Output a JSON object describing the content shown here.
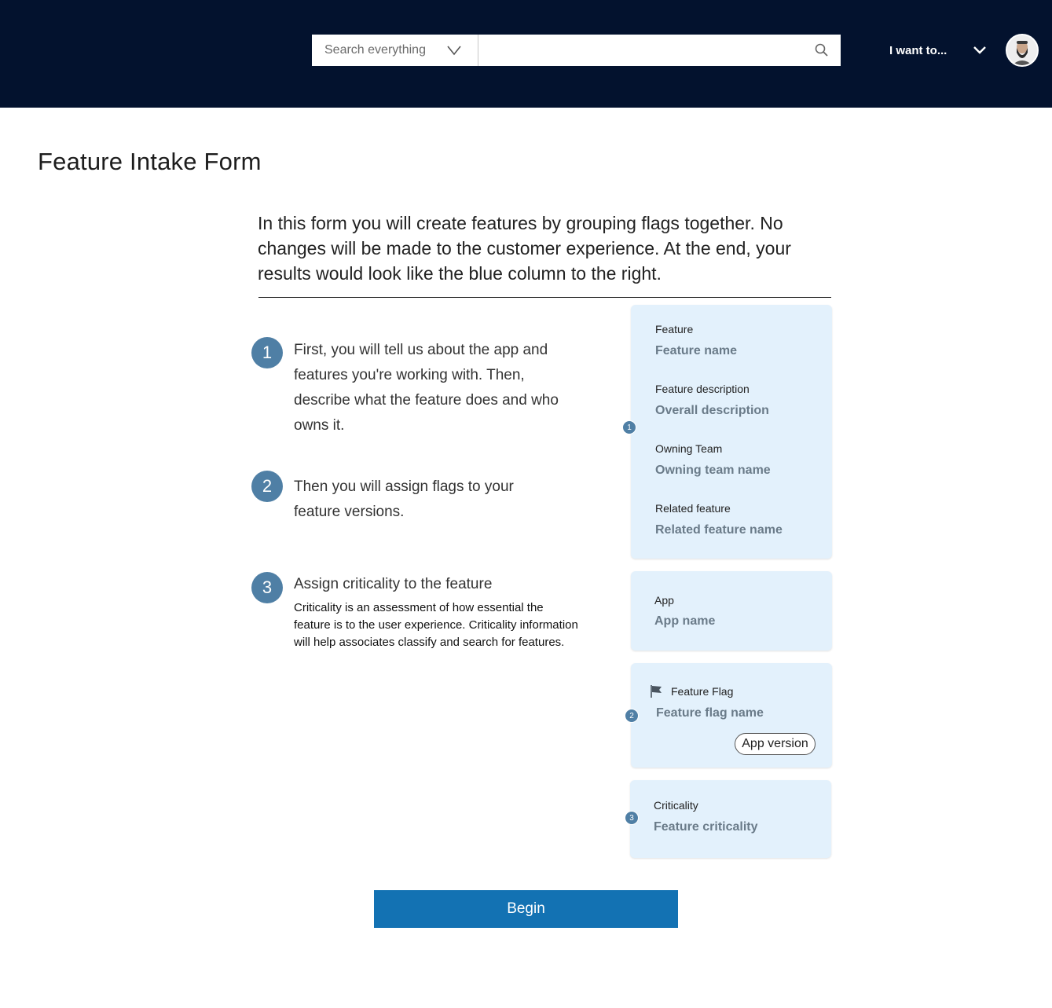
{
  "header": {
    "search": {
      "scope_label": "Search everything",
      "placeholder": "",
      "scope_chevron_icon": "chevron-down-icon",
      "search_icon": "magnifier-icon"
    },
    "i_want_to": "I want to...",
    "colors": {
      "background": "#03122e"
    }
  },
  "page": {
    "title": "Feature Intake Form",
    "intro": "In this form you will create features by grouping flags together. No changes will be made to the customer experience. At the end, your results would look like the blue column to the right."
  },
  "steps": [
    {
      "number": "1",
      "text": "First, you will tell us about the app and features you're working with. Then, describe what the feature does and who owns it."
    },
    {
      "number": "2",
      "text": "Then you will assign flags to your feature versions."
    },
    {
      "number": "3",
      "text": "Assign criticality to the feature",
      "subtext": "Criticality is an assessment of how essential the feature is to the user experience. Criticality information will help associates classify and search for features."
    }
  ],
  "preview": {
    "markers": [
      "1",
      "2",
      "3"
    ],
    "feature_card": {
      "fields": [
        {
          "label": "Feature",
          "value": "Feature name"
        },
        {
          "label": "Feature description",
          "value": "Overall description"
        },
        {
          "label": "Owning Team",
          "value": "Owning team name"
        },
        {
          "label": "Related feature",
          "value": "Related feature name"
        }
      ]
    },
    "app_card": {
      "label": "App",
      "value": "App name"
    },
    "flag_card": {
      "label": "Feature Flag",
      "value": "Feature flag name",
      "pill": "App version",
      "icon": "flag-icon"
    },
    "criticality_card": {
      "label": "Criticality",
      "value": "Feature criticality"
    },
    "colors": {
      "card_background": "#e3f1fc",
      "marker": "#4f7fa5"
    }
  },
  "actions": {
    "begin": "Begin",
    "color": "#1372b3"
  }
}
